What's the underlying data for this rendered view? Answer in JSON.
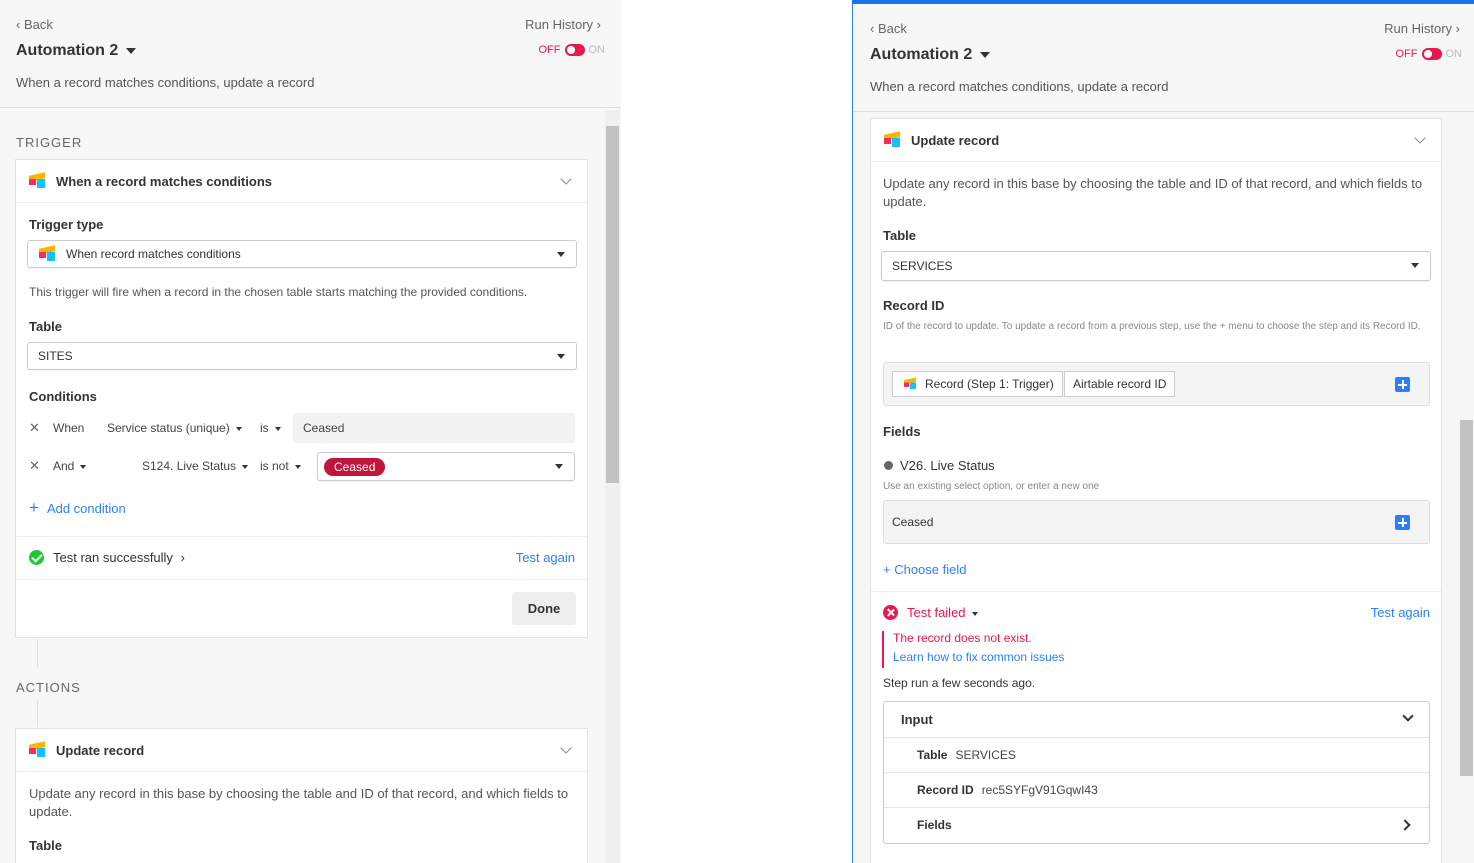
{
  "left": {
    "back_label": "Back",
    "run_history_label": "Run History",
    "automation_title": "Automation 2",
    "toggle_off": "OFF",
    "toggle_on": "ON",
    "description": "When a record matches conditions, update a record",
    "trigger_section": "TRIGGER",
    "trigger_card": {
      "title": "When a record matches conditions",
      "trigger_type_label": "Trigger type",
      "trigger_type_value": "When record matches conditions",
      "help_text": "This trigger will fire when a record in the chosen table starts matching the provided conditions.",
      "table_label": "Table",
      "table_value": "SITES",
      "conditions_label": "Conditions",
      "conditions": [
        {
          "connector": "When",
          "field": "Service status (unique)",
          "operator": "is",
          "value": "Ceased"
        },
        {
          "connector": "And",
          "field": "S124. Live Status",
          "operator": "is not",
          "value": "Ceased"
        }
      ],
      "add_condition": "Add condition",
      "test_status": "Test ran successfully",
      "test_again": "Test again",
      "done_button": "Done"
    },
    "actions_section": "ACTIONS",
    "action_card": {
      "title": "Update record",
      "description": "Update any record in this base by choosing the table and ID of that record, and which fields to update.",
      "table_label": "Table"
    }
  },
  "right": {
    "back_label": "Back",
    "run_history_label": "Run History",
    "automation_title": "Automation 2",
    "toggle_off": "OFF",
    "toggle_on": "ON",
    "description": "When a record matches conditions, update a record",
    "action_card": {
      "title": "Update record",
      "description": "Update any record in this base by choosing the table and ID of that record, and which fields to update.",
      "table_label": "Table",
      "table_value": "SERVICES",
      "record_id_label": "Record ID",
      "record_id_help": "ID of the record to update. To update a record from a previous step, use the + menu to choose the step and its Record ID.",
      "token_step": "Record (Step 1: Trigger)",
      "token_field": "Airtable record ID",
      "fields_label": "Fields",
      "field_name": "V26. Live Status",
      "field_help": "Use an existing select option, or enter a new one",
      "field_value": "Ceased",
      "choose_field": "+ Choose field",
      "test_status": "Test failed",
      "test_again": "Test again",
      "error_message": "The record does not exist.",
      "error_link": "Learn how to fix common issues",
      "step_run": "Step run a few seconds ago.",
      "input_header": "Input",
      "input_rows": [
        {
          "key": "Table",
          "value": "SERVICES"
        },
        {
          "key": "Record ID",
          "value": "rec5SYFgV91GqwI43"
        },
        {
          "key": "Fields",
          "value": ""
        }
      ]
    }
  },
  "colors": {
    "accent_blue": "#2d7ff9",
    "toggle_red": "#e8174d",
    "pill_red": "#c0163c",
    "success_green": "#20c933"
  }
}
